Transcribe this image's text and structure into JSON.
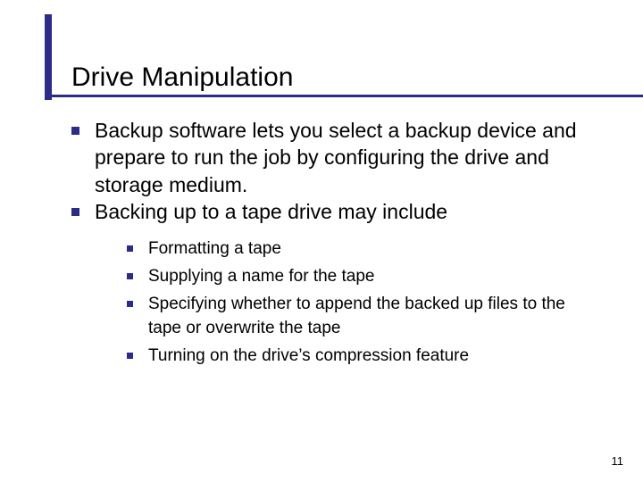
{
  "title": "Drive Manipulation",
  "bullets": [
    "Backup software lets you select a backup device and prepare to run the job by configuring the drive and storage medium.",
    "Backing up to a tape drive may include"
  ],
  "subbullets": [
    "Formatting a tape",
    "Supplying a name for the tape",
    "Specifying whether to append the backed up files to the tape or overwrite the tape",
    "Turning on the drive’s compression feature"
  ],
  "page_number": "11"
}
